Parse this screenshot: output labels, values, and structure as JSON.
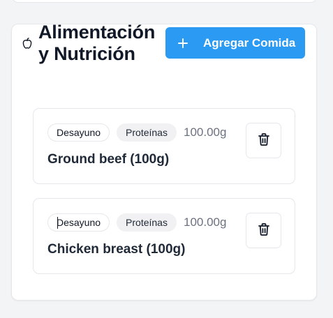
{
  "section": {
    "title": "Alimentación y Nutrición",
    "add_button_label": "Agregar Comida"
  },
  "entries": [
    {
      "meal": "Desayuno",
      "category": "Proteínas",
      "amount": "100.00g",
      "name": "Ground beef (100g)"
    },
    {
      "meal": "Desayuno",
      "category": "Proteínas",
      "amount": "100.00g",
      "name": "Chicken breast (100g)"
    }
  ],
  "icons": {
    "header": "apple-icon",
    "add": "plus-icon",
    "delete": "trash-icon"
  },
  "colors": {
    "primary": "#2b9af3",
    "muted_text": "#6b7280",
    "border": "#e5e7eb"
  }
}
